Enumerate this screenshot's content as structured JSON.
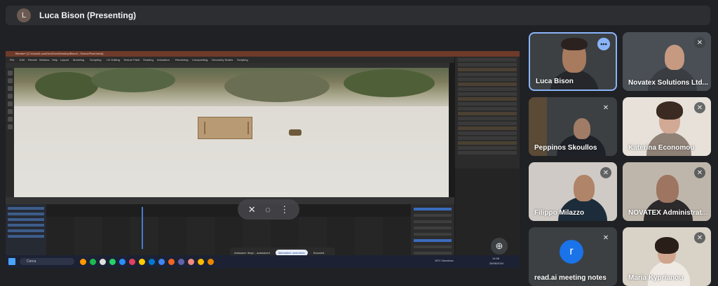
{
  "presenter": {
    "initial": "L",
    "title": "Luca Bison (Presenting)"
  },
  "blender": {
    "titlebar": "Blender* [C:\\Users\\Luca\\OneDrive\\Desktop\\Bison\\...\\SceneFinal.blend]",
    "menus": [
      "File",
      "Edit",
      "Render",
      "Window",
      "Help",
      "Layout",
      "Modeling",
      "Sculpting",
      "UV Editing",
      "Texture Paint",
      "Shading",
      "Animation",
      "Rendering",
      "Compositing",
      "Geometry Nodes",
      "Scripting"
    ],
    "toast_text": "Autosave: /tmp/... autosaved",
    "toast_button": "Alternative undo/redo",
    "toast_after": "Succeed"
  },
  "taskbar": {
    "search": "Cerca",
    "weather": "18°C  Nuvoloso",
    "time": "14:36",
    "date": "26/06/2024"
  },
  "overlay": {
    "pin_icon": "pin-off-icon",
    "mute_icon": "speaker-off-icon",
    "more_icon": "more-vert-icon"
  },
  "participants": [
    {
      "name": "Luca Bison",
      "state": "more"
    },
    {
      "name": "Novatex Solutions Ltd...",
      "state": "muted"
    },
    {
      "name": "Peppinos Skoullos",
      "state": "muted"
    },
    {
      "name": "Katerina Economou",
      "state": "muted"
    },
    {
      "name": "Filippo Milazzo",
      "state": "muted"
    },
    {
      "name": "NOVATEX Administrat...",
      "state": "muted"
    },
    {
      "name": "read.ai meeting notes",
      "state": "muted",
      "avatar": "r"
    },
    {
      "name": "Maria Kyprianou",
      "state": "muted"
    }
  ],
  "colors": {
    "accent": "#8ab4f8",
    "tile_bg": "#3c4043",
    "page_bg": "#202124"
  }
}
